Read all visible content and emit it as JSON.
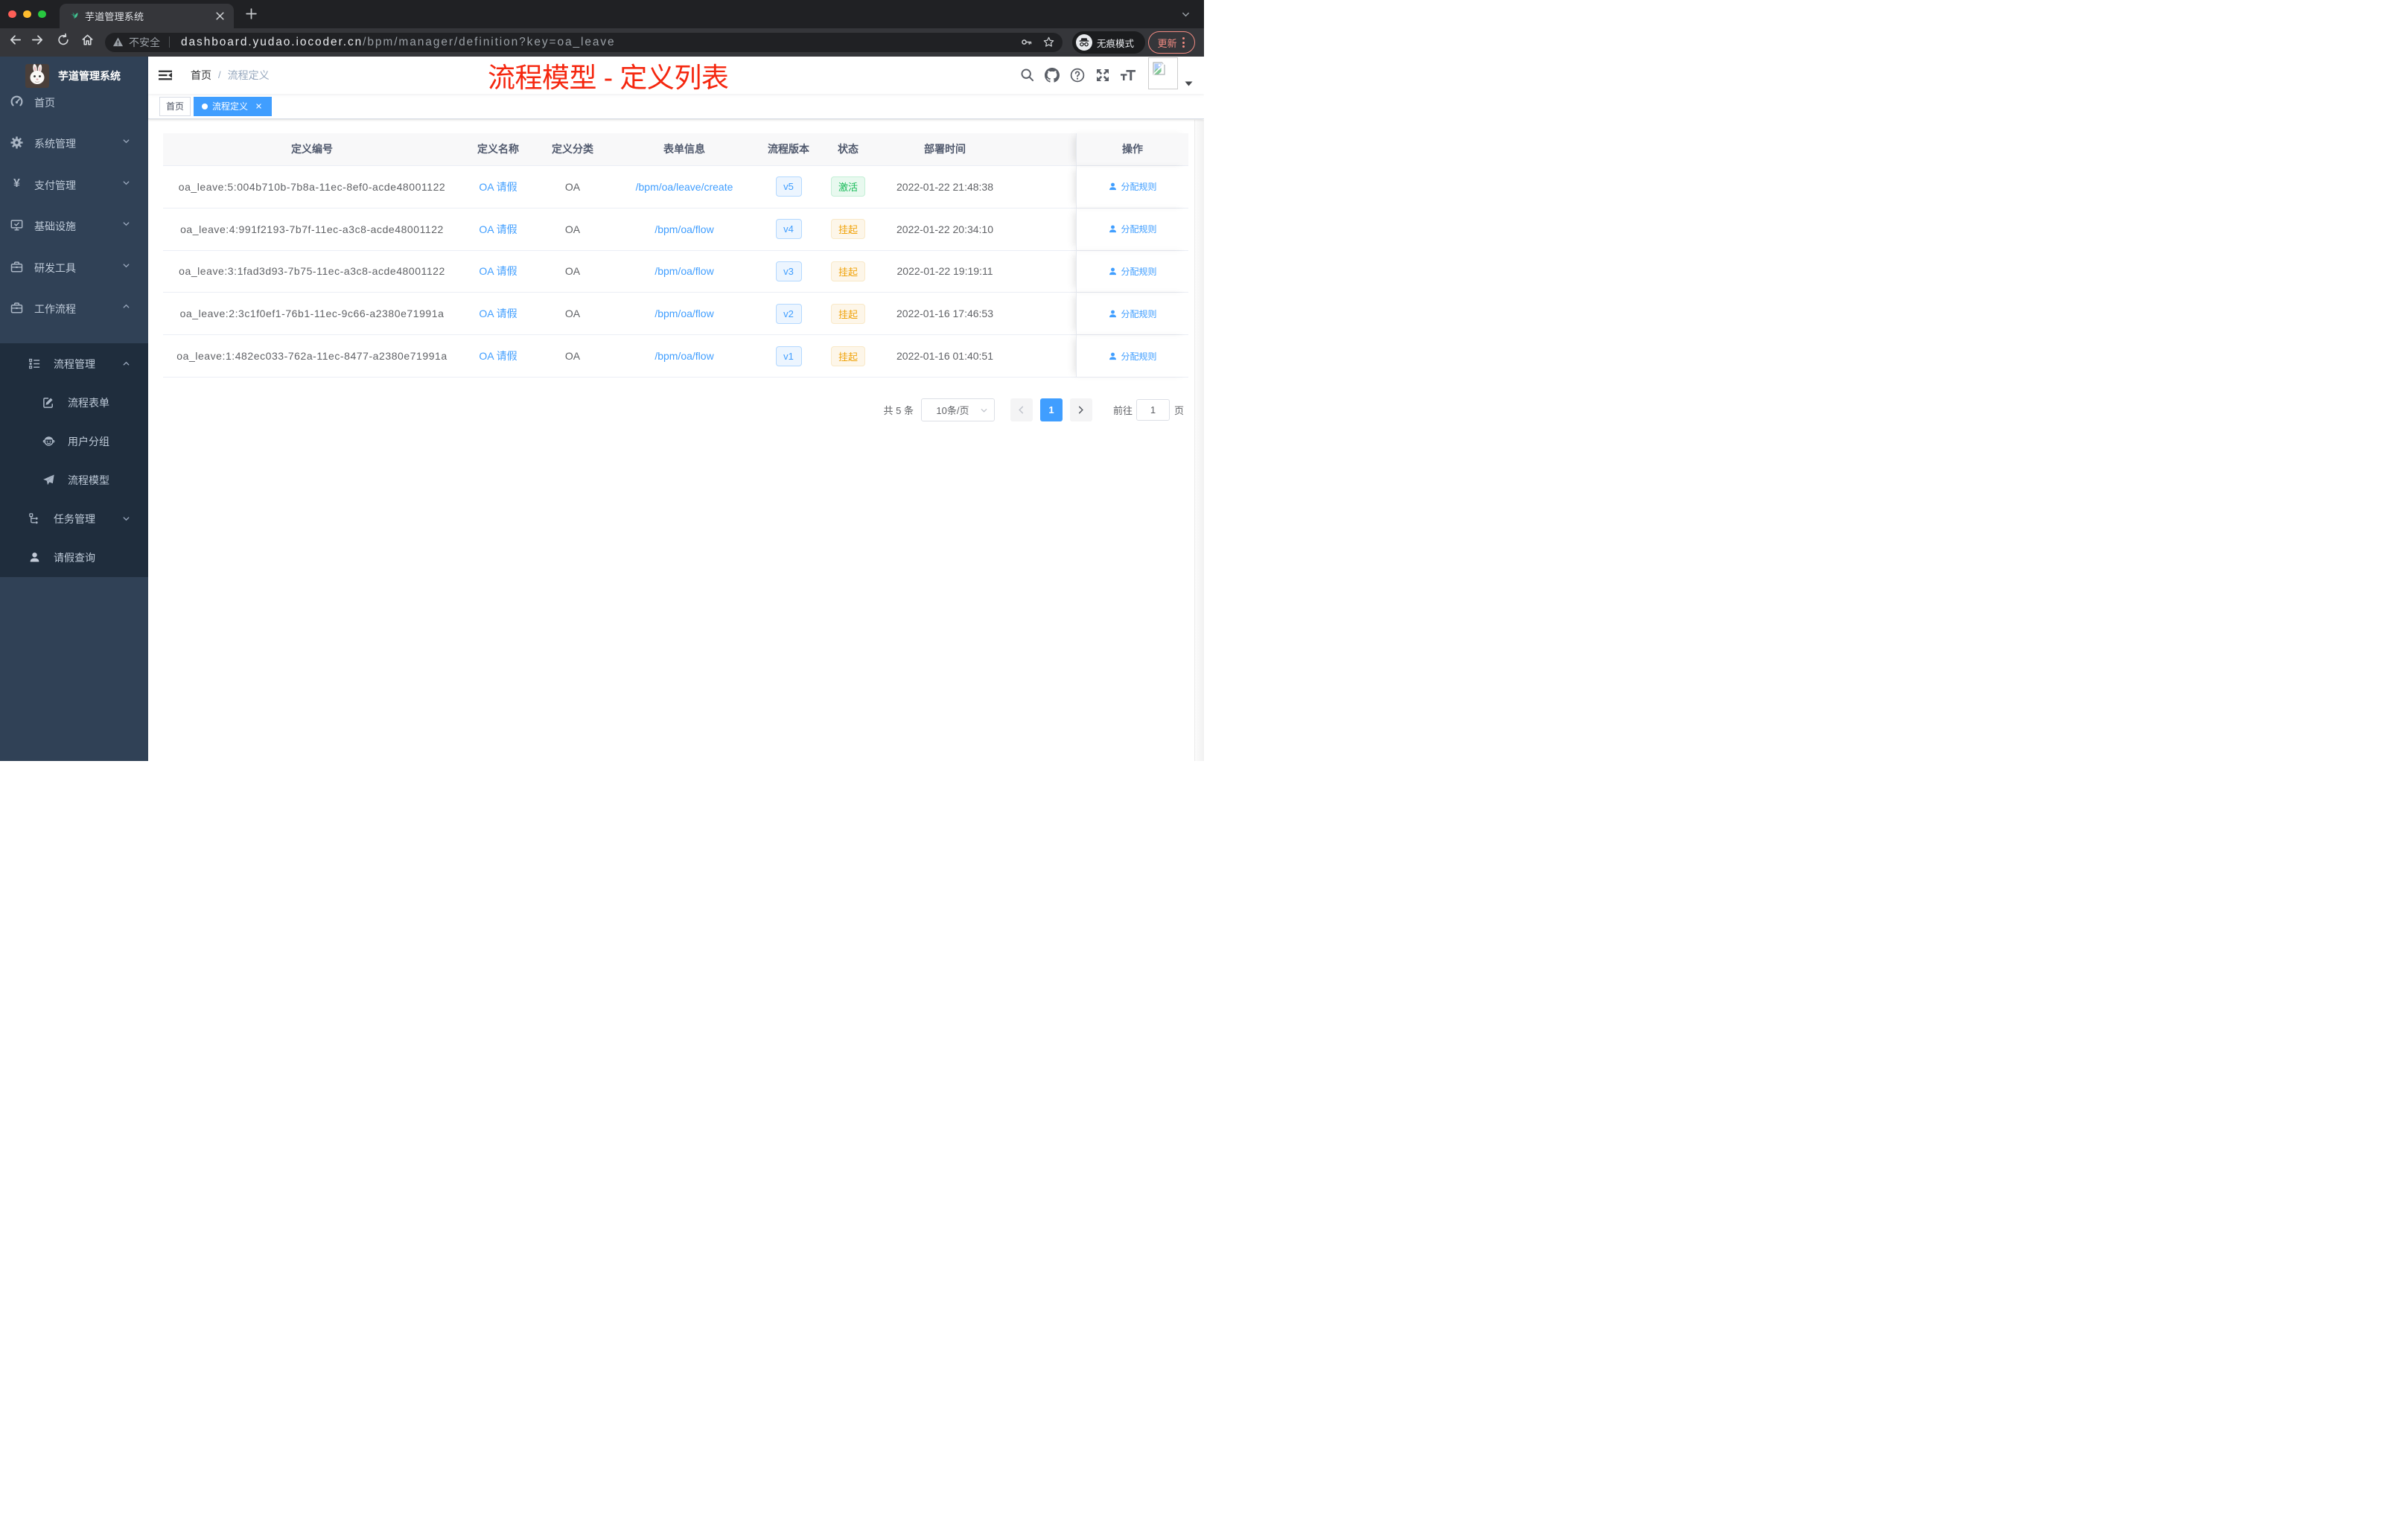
{
  "colors": {
    "primary": "#409eff",
    "annotation_red": "#f5270f",
    "success_text": "#15ba57",
    "warning_text": "#f0a30b",
    "sidebar_bg": "#304156",
    "submenu_bg": "#1f2d3d"
  },
  "browser": {
    "tab_title": "芋道管理系统",
    "security_label": "不安全",
    "url_host": "dashboard.yudao.iocoder.cn",
    "url_path": "/bpm/manager/definition?key=oa_leave",
    "incognito_label": "无痕模式",
    "update_label": "更新"
  },
  "sidebar": {
    "logo_title": "芋道管理系统",
    "items": [
      {
        "label": "首页",
        "icon": "dashboard-icon"
      },
      {
        "label": "系统管理",
        "icon": "gear-icon",
        "chevron": "down"
      },
      {
        "label": "支付管理",
        "icon": "yen-icon",
        "chevron": "down"
      },
      {
        "label": "基础设施",
        "icon": "monitor-icon",
        "chevron": "down"
      },
      {
        "label": "研发工具",
        "icon": "toolbox-icon",
        "chevron": "down"
      },
      {
        "label": "工作流程",
        "icon": "briefcase-icon",
        "chevron": "up"
      },
      {
        "label": "流程管理",
        "icon": "list-tree-icon",
        "chevron": "up"
      },
      {
        "label": "流程表单",
        "icon": "form-edit-icon"
      },
      {
        "label": "用户分组",
        "icon": "user-group-icon"
      },
      {
        "label": "流程模型",
        "icon": "paper-plane-icon"
      },
      {
        "label": "任务管理",
        "icon": "org-tree-icon",
        "chevron": "down"
      },
      {
        "label": "请假查询",
        "icon": "person-icon"
      }
    ]
  },
  "navbar": {
    "breadcrumb": {
      "home": "首页",
      "separator": "/",
      "current": "流程定义"
    },
    "annotation": "流程模型 - 定义列表"
  },
  "tags": [
    {
      "label": "首页",
      "active": false
    },
    {
      "label": "流程定义",
      "active": true
    }
  ],
  "table": {
    "columns": [
      "定义编号",
      "定义名称",
      "定义分类",
      "表单信息",
      "流程版本",
      "状态",
      "部署时间",
      "操作"
    ],
    "rows": [
      {
        "id": "oa_leave:5:004b710b-7b8a-11ec-8ef0-acde48001122",
        "name": "OA 请假",
        "category": "OA",
        "form": "/bpm/oa/leave/create",
        "version": "v5",
        "status": "激活",
        "status_type": "success",
        "time": "2022-01-22 21:48:38",
        "action": "分配规则"
      },
      {
        "id": "oa_leave:4:991f2193-7b7f-11ec-a3c8-acde48001122",
        "name": "OA 请假",
        "category": "OA",
        "form": "/bpm/oa/flow",
        "version": "v4",
        "status": "挂起",
        "status_type": "warning",
        "time": "2022-01-22 20:34:10",
        "action": "分配规则"
      },
      {
        "id": "oa_leave:3:1fad3d93-7b75-11ec-a3c8-acde48001122",
        "name": "OA 请假",
        "category": "OA",
        "form": "/bpm/oa/flow",
        "version": "v3",
        "status": "挂起",
        "status_type": "warning",
        "time": "2022-01-22 19:19:11",
        "action": "分配规则"
      },
      {
        "id": "oa_leave:2:3c1f0ef1-76b1-11ec-9c66-a2380e71991a",
        "name": "OA 请假",
        "category": "OA",
        "form": "/bpm/oa/flow",
        "version": "v2",
        "status": "挂起",
        "status_type": "warning",
        "time": "2022-01-16 17:46:53",
        "action": "分配规则"
      },
      {
        "id": "oa_leave:1:482ec033-762a-11ec-8477-a2380e71991a",
        "name": "OA 请假",
        "category": "OA",
        "form": "/bpm/oa/flow",
        "version": "v1",
        "status": "挂起",
        "status_type": "warning",
        "time": "2022-01-16 01:40:51",
        "action": "分配规则"
      }
    ]
  },
  "pagination": {
    "total": "共 5 条",
    "page_size": "10条/页",
    "current_page": "1",
    "jump_prefix": "前往",
    "jump_value": "1",
    "jump_suffix": "页"
  }
}
